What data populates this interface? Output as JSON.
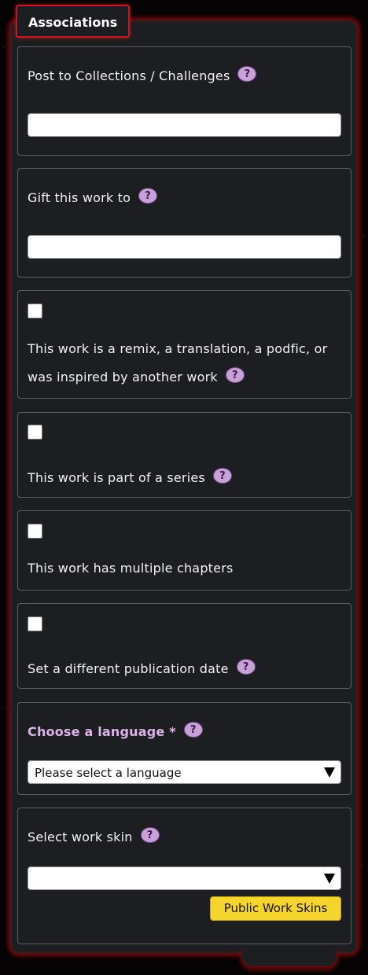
{
  "section": {
    "legend": "Associations"
  },
  "help_glyph": "?",
  "collections": {
    "label": "Post to Collections / Challenges",
    "value": ""
  },
  "gift": {
    "label": "Gift this work to",
    "value": ""
  },
  "remix": {
    "label": "This work is a remix, a translation, a podfic, or was inspired by another work",
    "checked": false
  },
  "series": {
    "label": "This work is part of a series",
    "checked": false
  },
  "chapters": {
    "label": "This work has multiple chapters",
    "checked": false
  },
  "pubdate": {
    "label": "Set a different publication date",
    "checked": false
  },
  "language": {
    "label": "Choose a language *",
    "selected": "Please select a language"
  },
  "skin": {
    "label": "Select work skin",
    "selected": "",
    "button": "Public Work Skins"
  },
  "colors": {
    "accent_red": "#c9141d",
    "help_purple": "#c9a1d9",
    "button_yellow": "#f5d42b",
    "panel_bg": "#1d1e21"
  }
}
